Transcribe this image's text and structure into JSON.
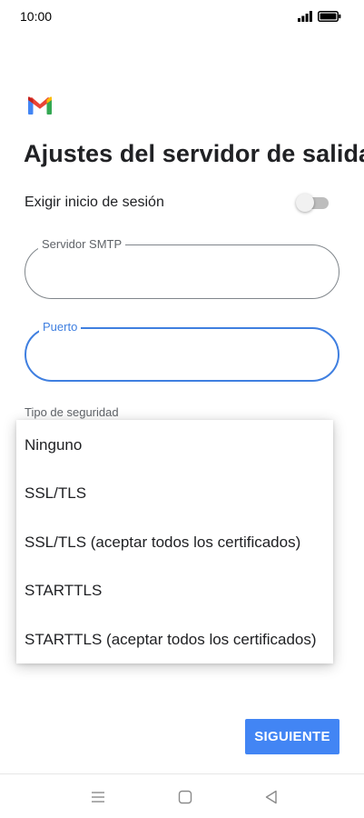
{
  "status_bar": {
    "time": "10:00",
    "icons": [
      "signal-icon",
      "battery-icon"
    ]
  },
  "app": {
    "logo_icon": "gmail-icon",
    "brand_colors": [
      "#ea4335",
      "#fbbc04",
      "#34a853",
      "#4285f4"
    ]
  },
  "page": {
    "title": "Ajustes del servidor de salida"
  },
  "login_toggle": {
    "label": "Exigir inicio de sesión",
    "enabled": false
  },
  "fields": {
    "smtp": {
      "label": "Servidor SMTP",
      "value": ""
    },
    "port": {
      "label": "Puerto",
      "value": "",
      "focused": true
    }
  },
  "security": {
    "label": "Tipo de seguridad",
    "options": [
      "Ninguno",
      "SSL/TLS",
      "SSL/TLS (aceptar todos los certificados)",
      "STARTTLS",
      "STARTTLS (aceptar todos los certificados)"
    ]
  },
  "actions": {
    "next_label": "SIGUIENTE"
  },
  "navigation": {
    "buttons": [
      "menu-icon",
      "home-icon",
      "back-icon"
    ]
  },
  "colors": {
    "accent": "#4285f4",
    "focus": "#3f7fe0"
  }
}
